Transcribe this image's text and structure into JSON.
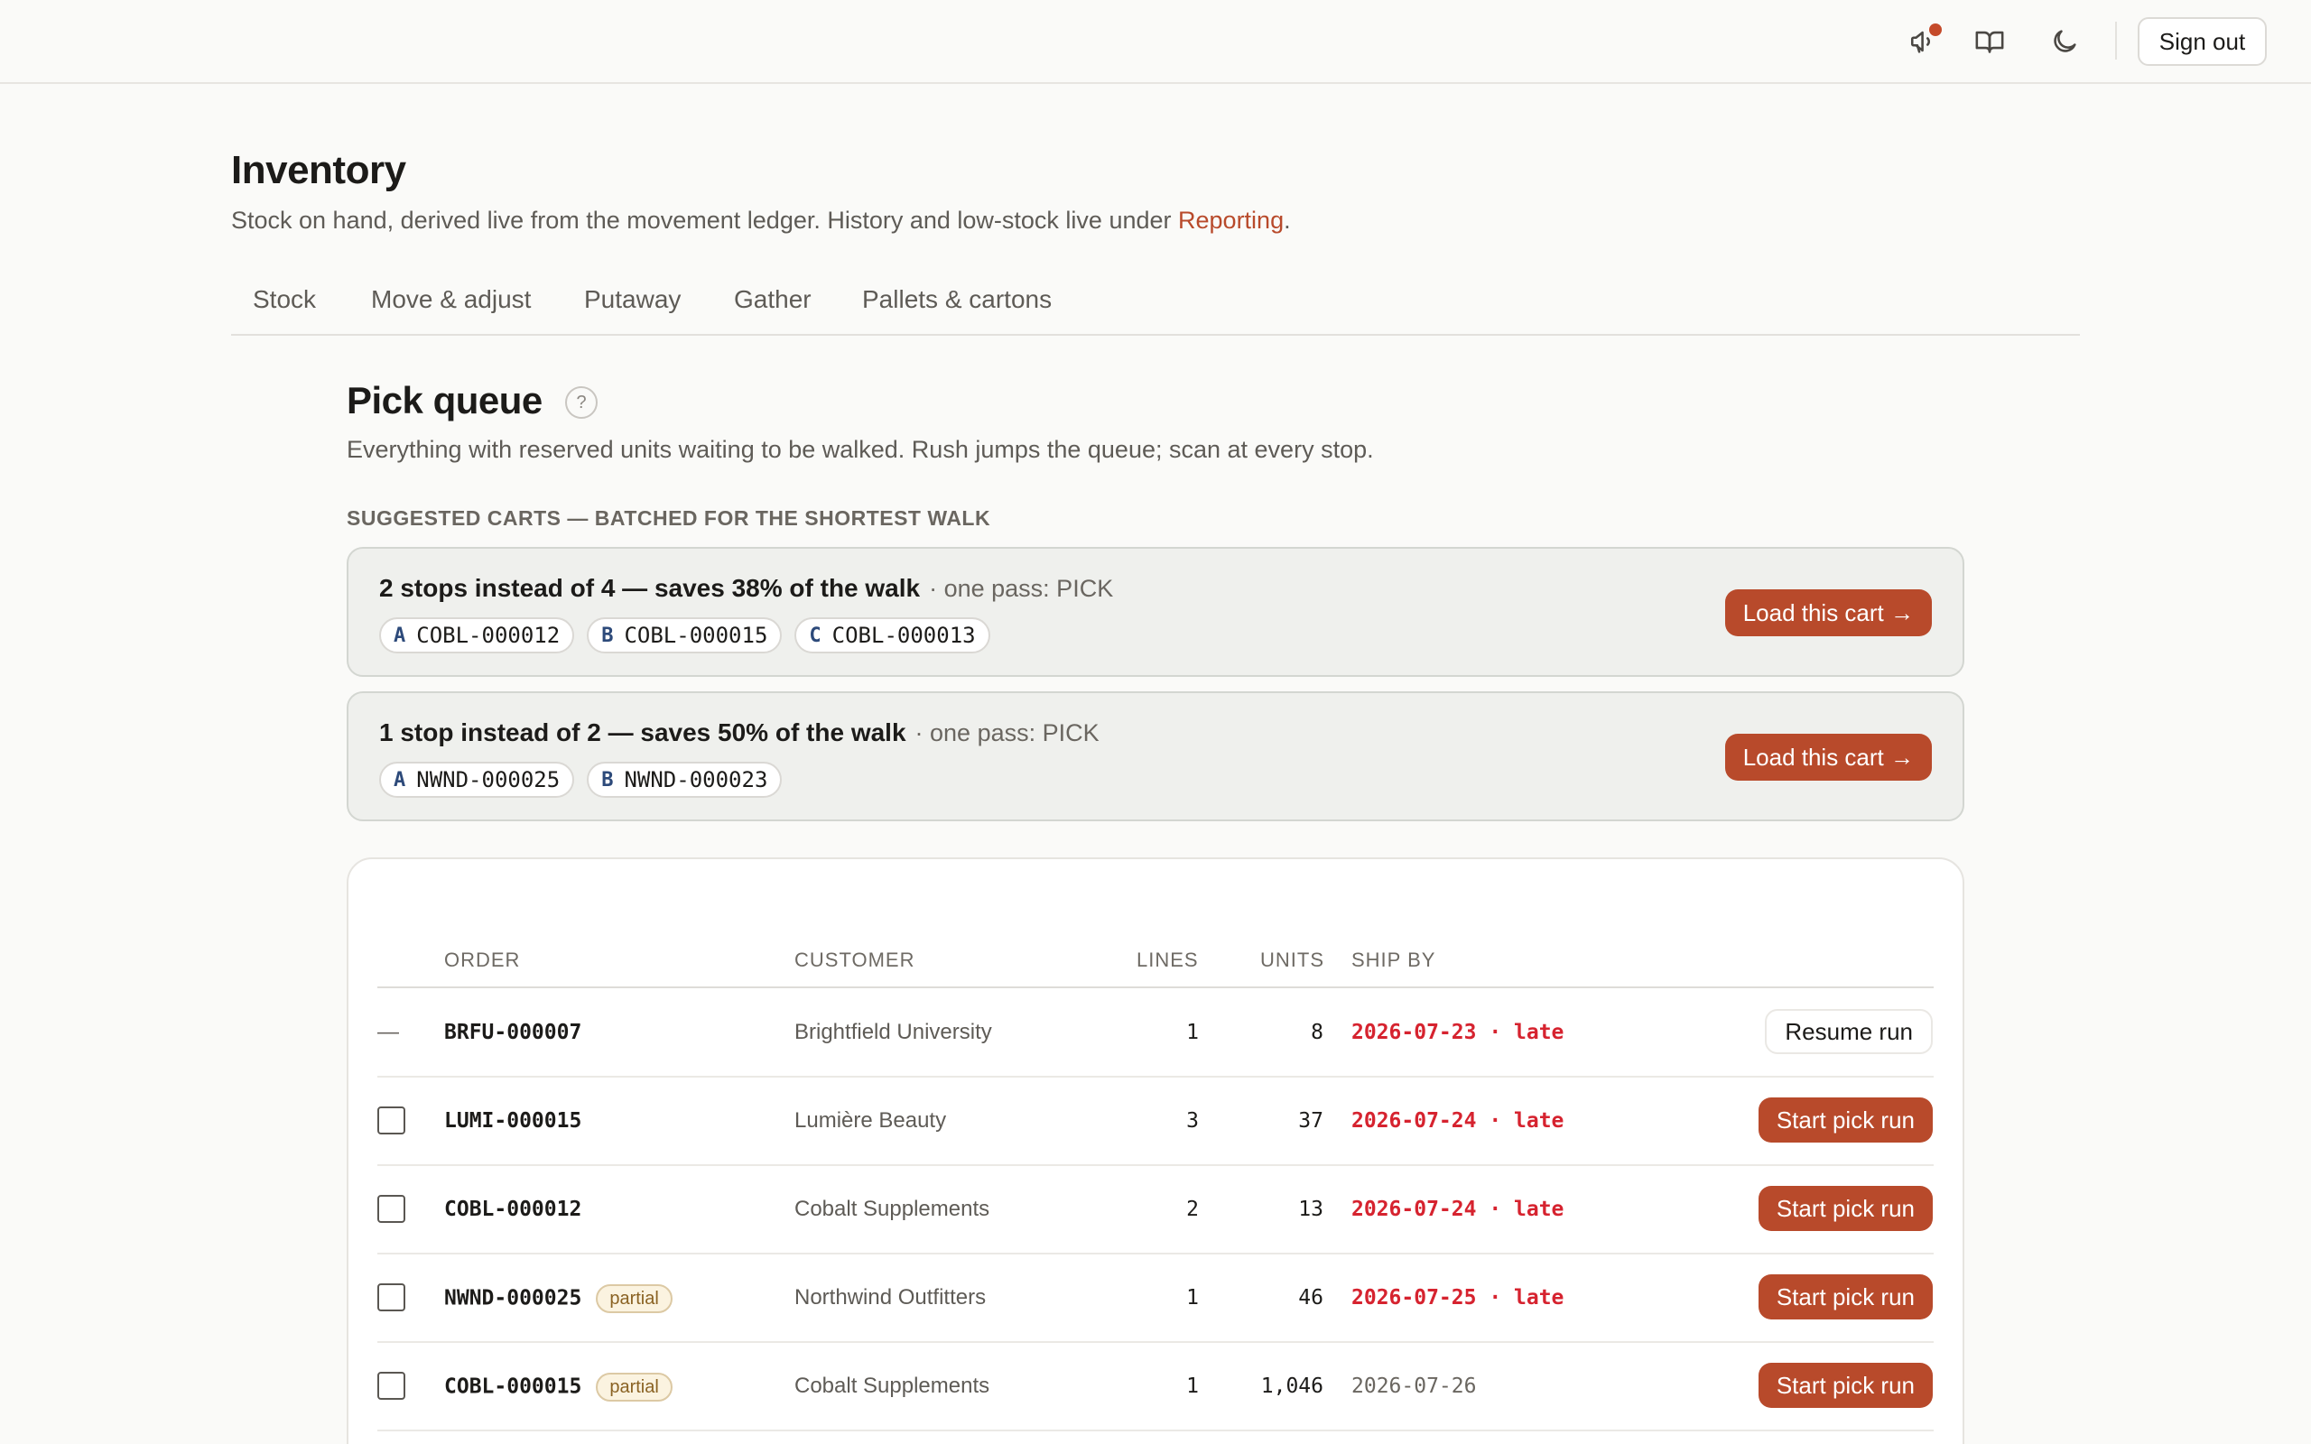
{
  "topbar": {
    "icons": [
      "megaphone-icon",
      "book-icon",
      "moon-icon"
    ],
    "sign_out": "Sign out",
    "accent": "#c44a2a"
  },
  "header": {
    "title": "Inventory",
    "subtitle_pre": "Stock on hand, derived live from the movement ledger. History and low-stock live under ",
    "subtitle_link": "Reporting",
    "subtitle_post": "."
  },
  "tabs": [
    "Stock",
    "Move & adjust",
    "Putaway",
    "Gather",
    "Pallets & cartons"
  ],
  "section": {
    "title": "Pick queue",
    "help": "?",
    "subtitle": "Everything with reserved units waiting to be walked. Rush jumps the queue; scan at every stop.",
    "carts_heading": "SUGGESTED CARTS — BATCHED FOR THE SHORTEST WALK"
  },
  "carts": [
    {
      "title": "2 stops instead of 4 — saves 38% of the walk",
      "pass": "· one pass: PICK",
      "chips": [
        {
          "letter": "A",
          "order": "COBL-000012"
        },
        {
          "letter": "B",
          "order": "COBL-000015"
        },
        {
          "letter": "C",
          "order": "COBL-000013"
        }
      ],
      "button": "Load this cart →"
    },
    {
      "title": "1 stop instead of 2 — saves 50% of the walk",
      "pass": "· one pass: PICK",
      "chips": [
        {
          "letter": "A",
          "order": "NWND-000025"
        },
        {
          "letter": "B",
          "order": "NWND-000023"
        }
      ],
      "button": "Load this cart →"
    }
  ],
  "table": {
    "headers": {
      "order": "ORDER",
      "customer": "CUSTOMER",
      "lines": "LINES",
      "units": "UNITS",
      "ship_by": "SHIP BY"
    },
    "rows": [
      {
        "select": "—",
        "order": "BRFU-000007",
        "badge": "",
        "customer": "Brightfield University",
        "lines": "1",
        "units": "8",
        "ship_by": "2026-07-23 · late",
        "late": true,
        "action": "Resume run"
      },
      {
        "select": "",
        "order": "LUMI-000015",
        "badge": "",
        "customer": "Lumière Beauty",
        "lines": "3",
        "units": "37",
        "ship_by": "2026-07-24 · late",
        "late": true,
        "action": "Start pick run"
      },
      {
        "select": "",
        "order": "COBL-000012",
        "badge": "",
        "customer": "Cobalt Supplements",
        "lines": "2",
        "units": "13",
        "ship_by": "2026-07-24 · late",
        "late": true,
        "action": "Start pick run"
      },
      {
        "select": "",
        "order": "NWND-000025",
        "badge": "partial",
        "customer": "Northwind Outfitters",
        "lines": "1",
        "units": "46",
        "ship_by": "2026-07-25 · late",
        "late": true,
        "action": "Start pick run"
      },
      {
        "select": "",
        "order": "COBL-000015",
        "badge": "partial",
        "customer": "Cobalt Supplements",
        "lines": "1",
        "units": "1,046",
        "ship_by": "2026-07-26",
        "late": false,
        "action": "Start pick run"
      }
    ]
  },
  "colors": {
    "accent": "#b84a2b",
    "late": "#d6232f",
    "cart_bg": "#eff0ed"
  }
}
